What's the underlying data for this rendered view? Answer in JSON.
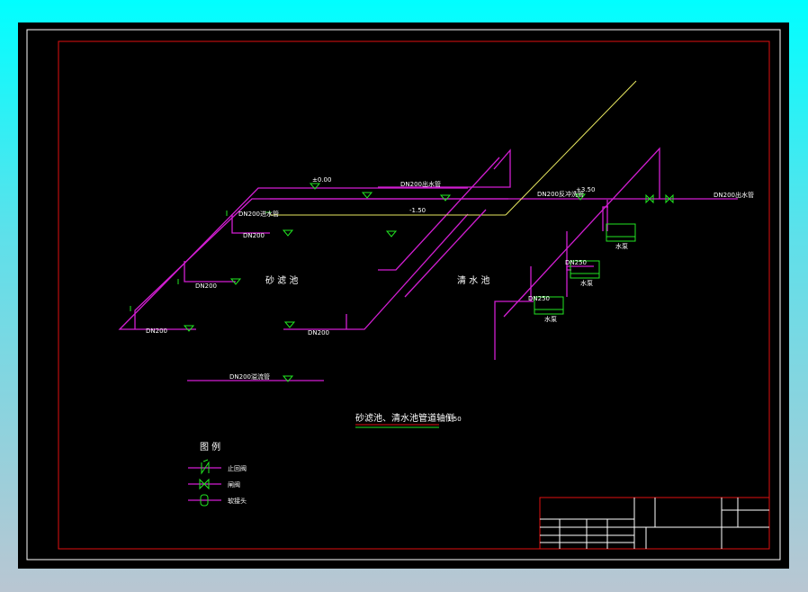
{
  "drawing": {
    "title": "砂滤池、清水池管道轴侧",
    "scale": "1:50",
    "tanks": {
      "sand_filter": "砂 滤 池",
      "clear_water": "清 水 池"
    },
    "pipe_labels": {
      "dn200": "DN200",
      "dn250": "DN250",
      "inlet": "DN200进水管",
      "outlet": "DN200出水管",
      "backwash": "DN200反冲洗管",
      "overflow": "DN200溢流管",
      "level1": "±0.00",
      "level2": "-1.50",
      "level3": "+3.50"
    },
    "pump_label": "水泵",
    "legend": {
      "title": "图 例",
      "items": [
        {
          "icon": "check-valve-icon",
          "label": "止回阀"
        },
        {
          "icon": "gate-valve-icon",
          "label": "闸阀"
        },
        {
          "icon": "flexible-joint-icon",
          "label": "软接头"
        }
      ]
    }
  },
  "colors": {
    "pipe": "#d21ed2",
    "yellow_pipe": "#e8e860",
    "equipment": "#22e622",
    "frame": "#e01010"
  }
}
